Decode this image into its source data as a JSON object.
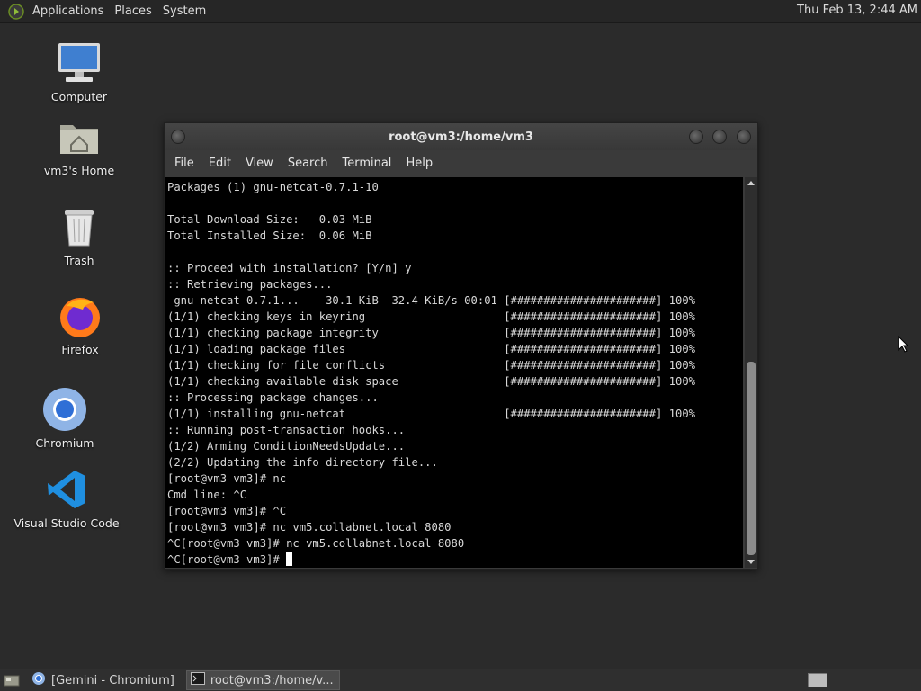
{
  "top_panel": {
    "menus": [
      "Applications",
      "Places",
      "System"
    ],
    "clock": "Thu Feb 13,  2:44 AM"
  },
  "desktop_icons": [
    {
      "label": "Computer",
      "icon": "computer-icon"
    },
    {
      "label": "vm3's Home",
      "icon": "home-folder-icon"
    },
    {
      "label": "Trash",
      "icon": "trash-icon"
    },
    {
      "label": "Firefox",
      "icon": "firefox-icon"
    },
    {
      "label": "Chromium",
      "icon": "chromium-icon"
    },
    {
      "label": "Visual Studio Code",
      "icon": "vscode-icon"
    }
  ],
  "terminal": {
    "title": "root@vm3:/home/vm3",
    "menu": [
      "File",
      "Edit",
      "View",
      "Search",
      "Terminal",
      "Help"
    ],
    "lines": [
      "Packages (1) gnu-netcat-0.7.1-10",
      "",
      "Total Download Size:   0.03 MiB",
      "Total Installed Size:  0.06 MiB",
      "",
      ":: Proceed with installation? [Y/n] y",
      ":: Retrieving packages...",
      " gnu-netcat-0.7.1...    30.1 KiB  32.4 KiB/s 00:01 [######################] 100%",
      "(1/1) checking keys in keyring                     [######################] 100%",
      "(1/1) checking package integrity                   [######################] 100%",
      "(1/1) loading package files                        [######################] 100%",
      "(1/1) checking for file conflicts                  [######################] 100%",
      "(1/1) checking available disk space                [######################] 100%",
      ":: Processing package changes...",
      "(1/1) installing gnu-netcat                        [######################] 100%",
      ":: Running post-transaction hooks...",
      "(1/2) Arming ConditionNeedsUpdate...",
      "(2/2) Updating the info directory file...",
      "[root@vm3 vm3]# nc",
      "Cmd line: ^C",
      "[root@vm3 vm3]# ^C",
      "[root@vm3 vm3]# nc vm5.collabnet.local 8080",
      "^C[root@vm3 vm3]# nc vm5.collabnet.local 8080",
      "^C[root@vm3 vm3]# "
    ]
  },
  "taskbar": {
    "tasks": [
      {
        "label": "[Gemini - Chromium]",
        "icon": "chromium-icon",
        "active": false
      },
      {
        "label": "root@vm3:/home/v...",
        "icon": "terminal-icon",
        "active": true
      }
    ]
  },
  "colors": {
    "desktop_bg": "#2b2b2b",
    "terminal_bg": "#000000",
    "terminal_fg": "#d8d8d8"
  }
}
